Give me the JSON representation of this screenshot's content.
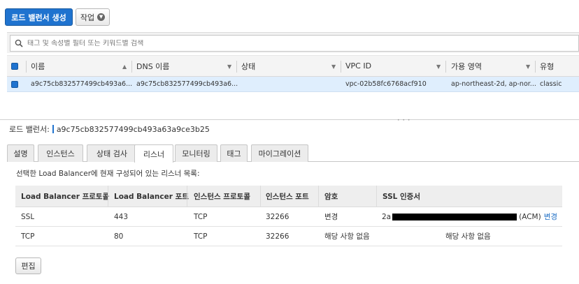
{
  "toolbar": {
    "create_button": "로드 밸런서 생성",
    "actions_button": "작업"
  },
  "search": {
    "placeholder": "태그 및 속성별 필터 또는 키워드별 검색"
  },
  "grid": {
    "columns": [
      "이름",
      "DNS 이름",
      "상태",
      "VPC ID",
      "가용 영역",
      "유형"
    ],
    "row": {
      "name": "a9c75cb832577499cb493a6...",
      "dns": "a9c75cb832577499cb493a6...",
      "state": "",
      "vpc": "vpc-02b58fc6768acf910",
      "az": "ap-northeast-2d, ap-nor...",
      "type": "classic"
    }
  },
  "detail": {
    "label": "로드 밸런서:",
    "name": "a9c75cb832577499cb493a63a9ce3b25"
  },
  "tabs": [
    "설명",
    "인스턴스",
    "상태 검사",
    "리스너",
    "모니터링",
    "태그",
    "마이그레이션"
  ],
  "active_tab": "리스너",
  "listeners": {
    "description": "선택한 Load Balancer에 현재 구성되어 있는 리스너 목록:",
    "headers": [
      "Load Balancer 프로토콜",
      "Load Balancer 포트",
      "인스턴스 프로토콜",
      "인스턴스 포트",
      "암호",
      "SSL 인증서"
    ],
    "rows": [
      {
        "lb_protocol": "SSL",
        "lb_port": "443",
        "inst_protocol": "TCP",
        "inst_port": "32266",
        "cipher": "변경",
        "cert_prefix": "2a",
        "cert_suffix": "(ACM)",
        "cert_action": "변경"
      },
      {
        "lb_protocol": "TCP",
        "lb_port": "80",
        "inst_protocol": "TCP",
        "inst_port": "32266",
        "cipher": "해당 사항 없음",
        "cert": "해당 사항 없음"
      }
    ]
  },
  "edit_button": "편집"
}
